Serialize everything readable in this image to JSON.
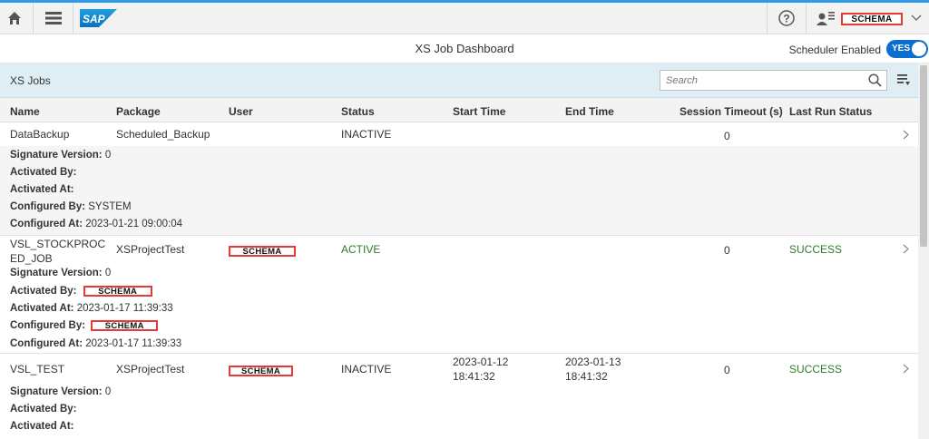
{
  "shell": {
    "logo_text": "SAP",
    "user_name": "SCHEMA",
    "icons": [
      "home-icon",
      "menu-icon",
      "help-icon",
      "user-icon",
      "chevron-down-icon"
    ]
  },
  "header": {
    "title": "XS Job Dashboard",
    "scheduler_label": "Scheduler Enabled",
    "toggle_label": "YES"
  },
  "toolbar": {
    "title": "XS Jobs",
    "search_placeholder": "Search"
  },
  "columns": [
    "Name",
    "Package",
    "User",
    "Status",
    "Start Time",
    "End Time",
    "Session Timeout (s)",
    "Last Run Status"
  ],
  "jobs": [
    {
      "name": "DataBackup",
      "package": "Scheduled_Backup",
      "user": "",
      "status": "INACTIVE",
      "start_time": "",
      "end_time": "",
      "session_timeout": "0",
      "last_run_status": "",
      "details": [
        {
          "label": "Signature Version:",
          "value": "0"
        },
        {
          "label": "Activated By:",
          "value": ""
        },
        {
          "label": "Activated At:",
          "value": ""
        },
        {
          "label": "Configured By:",
          "value": "SYSTEM"
        },
        {
          "label": "Configured At:",
          "value": "2023-01-21 09:00:04"
        }
      ]
    },
    {
      "name_line1": "VSL_STOCKPROC",
      "name_line2": "ED_JOB",
      "package": "XSProjectTest",
      "user": "SCHEMA",
      "status": "ACTIVE",
      "start_time": "",
      "end_time": "",
      "session_timeout": "0",
      "last_run_status": "SUCCESS",
      "details": [
        {
          "label": "Signature Version:",
          "value": "0"
        },
        {
          "label": "Activated By:",
          "value": "SCHEMA"
        },
        {
          "label": "Activated At:",
          "value": "2023-01-17 11:39:33"
        },
        {
          "label": "Configured By:",
          "value": "SCHEMA"
        },
        {
          "label": "Configured At:",
          "value": "2023-01-17 11:39:33"
        }
      ]
    },
    {
      "name": "VSL_TEST",
      "package": "XSProjectTest",
      "user": "SCHEMA",
      "status": "INACTIVE",
      "start_date": "2023-01-12",
      "start_clock": "18:41:32",
      "end_date": "2023-01-13",
      "end_clock": "18:41:32",
      "session_timeout": "0",
      "last_run_status": "SUCCESS",
      "details": [
        {
          "label": "Signature Version:",
          "value": "0"
        },
        {
          "label": "Activated By:",
          "value": ""
        },
        {
          "label": "Activated At:",
          "value": ""
        }
      ]
    }
  ],
  "colors": {
    "accent": "#0a6ed1",
    "toolbar_bg": "#dfeef4",
    "success": "#2b7d2b",
    "redaction_border": "#e53935"
  }
}
